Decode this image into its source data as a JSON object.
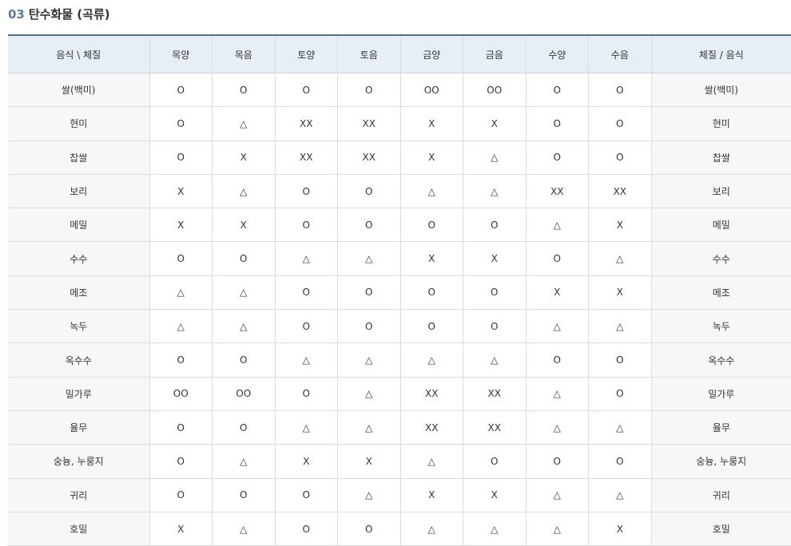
{
  "section": {
    "number": "03",
    "title": "탄수화물 (곡류)"
  },
  "table": {
    "headers": [
      "음식 \\ 체질",
      "목양",
      "목음",
      "토양",
      "토음",
      "금양",
      "금음",
      "수양",
      "수음",
      "체질 / 음식"
    ],
    "rows": [
      {
        "food": "쌀(백미)",
        "cells": [
          "O",
          "O",
          "O",
          "O",
          "OO",
          "OO",
          "O",
          "O"
        ]
      },
      {
        "food": "현미",
        "cells": [
          "O",
          "△",
          "XX",
          "XX",
          "X",
          "X",
          "O",
          "O"
        ]
      },
      {
        "food": "찹쌀",
        "cells": [
          "O",
          "X",
          "XX",
          "XX",
          "X",
          "△",
          "O",
          "O"
        ]
      },
      {
        "food": "보리",
        "cells": [
          "X",
          "△",
          "O",
          "O",
          "△",
          "△",
          "XX",
          "XX"
        ]
      },
      {
        "food": "메밀",
        "cells": [
          "X",
          "X",
          "O",
          "O",
          "O",
          "O",
          "△",
          "X"
        ]
      },
      {
        "food": "수수",
        "cells": [
          "O",
          "O",
          "△",
          "△",
          "X",
          "X",
          "O",
          "△"
        ]
      },
      {
        "food": "메조",
        "cells": [
          "△",
          "△",
          "O",
          "O",
          "O",
          "O",
          "X",
          "X"
        ]
      },
      {
        "food": "녹두",
        "cells": [
          "△",
          "△",
          "O",
          "O",
          "O",
          "O",
          "△",
          "△"
        ]
      },
      {
        "food": "옥수수",
        "cells": [
          "O",
          "O",
          "△",
          "△",
          "△",
          "△",
          "O",
          "O"
        ]
      },
      {
        "food": "밀가루",
        "cells": [
          "OO",
          "OO",
          "O",
          "△",
          "XX",
          "XX",
          "△",
          "O"
        ]
      },
      {
        "food": "율무",
        "cells": [
          "O",
          "O",
          "△",
          "△",
          "XX",
          "XX",
          "△",
          "△"
        ]
      },
      {
        "food": "숭늉, 누룽지",
        "cells": [
          "O",
          "△",
          "X",
          "X",
          "△",
          "O",
          "O",
          "O"
        ]
      },
      {
        "food": "귀리",
        "cells": [
          "O",
          "O",
          "O",
          "△",
          "X",
          "X",
          "△",
          "△"
        ]
      },
      {
        "food": "호밀",
        "cells": [
          "X",
          "△",
          "O",
          "O",
          "△",
          "△",
          "△",
          "X"
        ]
      }
    ]
  }
}
